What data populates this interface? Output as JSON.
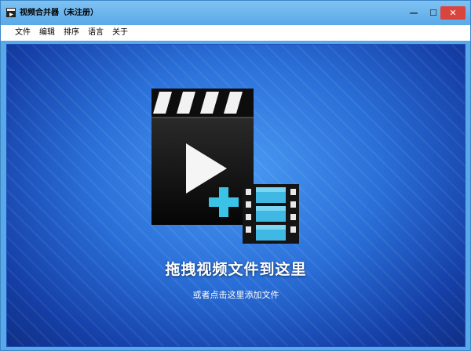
{
  "window": {
    "title": "视频合并器（未注册）",
    "minimize_glyph": "—",
    "maximize_glyph": "☐",
    "close_glyph": "✕"
  },
  "menu": {
    "items": [
      {
        "label": "文件"
      },
      {
        "label": "编辑"
      },
      {
        "label": "排序"
      },
      {
        "label": "语言"
      },
      {
        "label": "关于"
      }
    ]
  },
  "drop_zone": {
    "title": "拖拽视频文件到这里",
    "subtitle": "或者点击这里添加文件",
    "icons": [
      "clapperboard-play-icon",
      "plus-icon",
      "film-strip-icon"
    ]
  },
  "colors": {
    "titlebar": "#5aa9e8",
    "close_button": "#d9443c",
    "background_blue": "#2a6fd8",
    "accent_cyan": "#3ac3e6"
  }
}
